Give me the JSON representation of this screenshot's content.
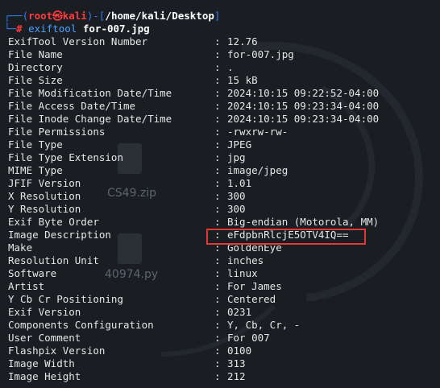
{
  "prompt": {
    "open": "┌──(",
    "user": "root",
    "at": "㉿",
    "host": "kali",
    "path_prefix": ")-[",
    "path": "/home/kali/Desktop",
    "path_suffix": "]",
    "line2_prefix": "└─",
    "symbol": "#",
    "command": "exiftool",
    "argument": "for-007.jpg"
  },
  "desktop_bg": {
    "file1": "CS49.zip",
    "file2": "40974.py"
  },
  "rows": [
    {
      "key": "ExifTool Version Number",
      "value": "12.76"
    },
    {
      "key": "File Name",
      "value": "for-007.jpg"
    },
    {
      "key": "Directory",
      "value": "."
    },
    {
      "key": "File Size",
      "value": "15 kB"
    },
    {
      "key": "File Modification Date/Time",
      "value": "2024:10:15 09:22:52-04:00"
    },
    {
      "key": "File Access Date/Time",
      "value": "2024:10:15 09:23:34-04:00"
    },
    {
      "key": "File Inode Change Date/Time",
      "value": "2024:10:15 09:23:34-04:00"
    },
    {
      "key": "File Permissions",
      "value": "-rwxrw-rw-"
    },
    {
      "key": "File Type",
      "value": "JPEG"
    },
    {
      "key": "File Type Extension",
      "value": "jpg"
    },
    {
      "key": "MIME Type",
      "value": "image/jpeg"
    },
    {
      "key": "JFIF Version",
      "value": "1.01"
    },
    {
      "key": "X Resolution",
      "value": "300"
    },
    {
      "key": "Y Resolution",
      "value": "300"
    },
    {
      "key": "Exif Byte Order",
      "value": "Big-endian (Motorola, MM)"
    },
    {
      "key": "Image Description",
      "value": "eFdpbnRlcjE5OTV4IQ=="
    },
    {
      "key": "Make",
      "value": "GoldenEye"
    },
    {
      "key": "Resolution Unit",
      "value": "inches"
    },
    {
      "key": "Software",
      "value": "linux"
    },
    {
      "key": "Artist",
      "value": "For James"
    },
    {
      "key": "Y Cb Cr Positioning",
      "value": "Centered"
    },
    {
      "key": "Exif Version",
      "value": "0231"
    },
    {
      "key": "Components Configuration",
      "value": "Y, Cb, Cr, -"
    },
    {
      "key": "User Comment",
      "value": "For 007"
    },
    {
      "key": "Flashpix Version",
      "value": "0100"
    },
    {
      "key": "Image Width",
      "value": "313"
    },
    {
      "key": "Image Height",
      "value": "212"
    }
  ],
  "separator": ":"
}
